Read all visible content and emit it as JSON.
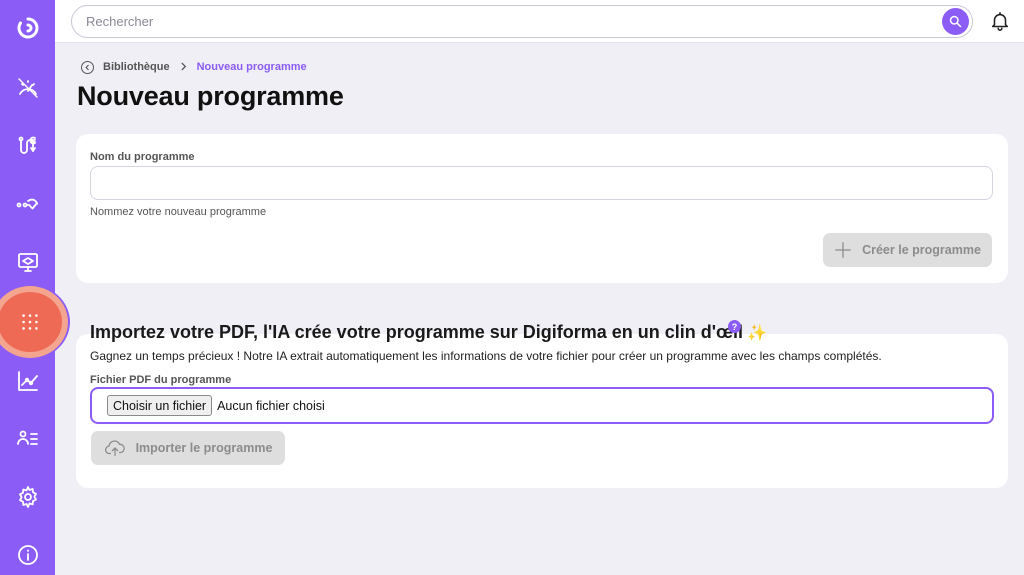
{
  "search": {
    "placeholder": "Rechercher"
  },
  "breadcrumb": {
    "parent": "Bibliothèque",
    "current": "Nouveau programme"
  },
  "page": {
    "title": "Nouveau programme"
  },
  "create_form": {
    "name_label": "Nom du programme",
    "name_value": "",
    "hint": "Nommez votre nouveau programme",
    "submit_label": "Créer le programme"
  },
  "import_section": {
    "title": "Importez votre PDF, l'IA crée votre programme sur Digiforma en un clin d'œil",
    "sparkle": "✨",
    "help": "?",
    "description": "Gagnez un temps précieux ! Notre IA extrait automatiquement les informations de votre fichier pour créer un programme avec les champs complétés.",
    "file_label": "Fichier PDF du programme",
    "file_button": "Choisir un fichier",
    "file_status": "Aucun fichier choisi",
    "submit_label": "Importer le programme"
  },
  "sidebar": {
    "items": [
      {
        "icon": "logo-icon"
      },
      {
        "icon": "gauge-icon"
      },
      {
        "icon": "funding-icon"
      },
      {
        "icon": "route-check-icon"
      },
      {
        "icon": "training-screen-icon"
      },
      {
        "icon": "grid-dots-icon",
        "active": true
      },
      {
        "icon": "chart-line-icon"
      },
      {
        "icon": "users-list-icon"
      },
      {
        "icon": "settings-icon"
      },
      {
        "icon": "info-icon"
      }
    ]
  },
  "colors": {
    "accent": "#8b5cf6",
    "active_item": "#ee6a55",
    "background": "#f0eff6"
  }
}
